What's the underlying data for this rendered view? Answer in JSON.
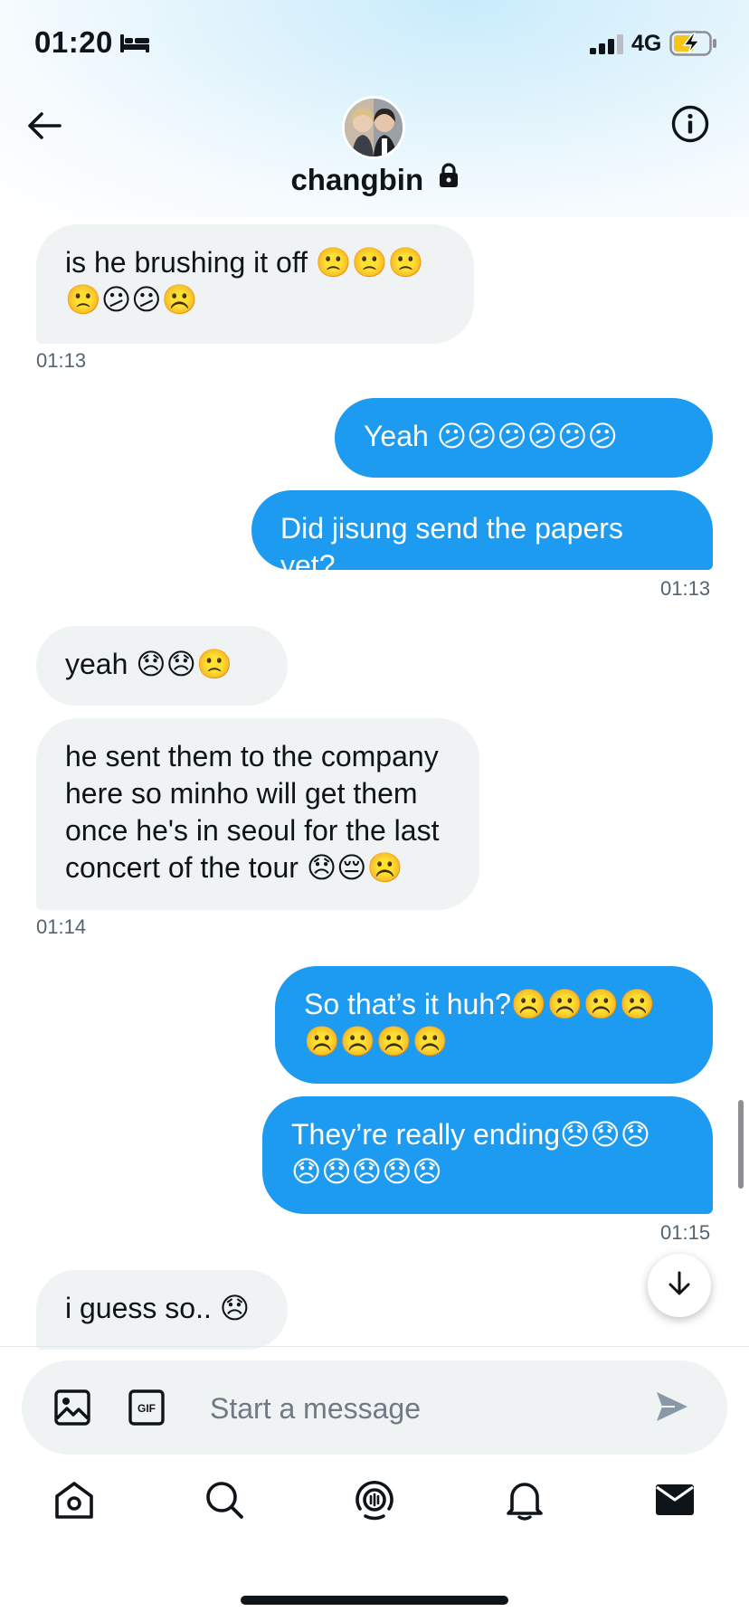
{
  "status_bar": {
    "time": "01:20",
    "network": "4G",
    "icons": [
      "bed-icon",
      "signal-icon",
      "battery-charging-icon"
    ]
  },
  "header": {
    "contact_name": "changbin",
    "icons": [
      "back-arrow-icon",
      "lock-icon",
      "info-icon"
    ]
  },
  "messages": [
    {
      "side": "received",
      "text": "is he brushing it off 🙁🙁🙁 🙁😕😕☹️"
    },
    {
      "side": "timestamp",
      "text": "01:13"
    },
    {
      "side": "sent",
      "text": "Yeah 😕😕😕😕😕😕"
    },
    {
      "side": "sent",
      "text": "Did jisung send the papers yet?"
    },
    {
      "side": "timestamp",
      "text": "01:13"
    },
    {
      "side": "received",
      "text": "yeah 😞😞🙁"
    },
    {
      "side": "received",
      "text": "he sent them to the company here so minho will get them once he's in seoul for the last concert of the tour 😞😔☹️"
    },
    {
      "side": "timestamp",
      "text": "01:14"
    },
    {
      "side": "sent",
      "text": "So that’s it huh?☹️☹️☹️☹️ ☹️☹️☹️☹️"
    },
    {
      "side": "sent",
      "text": "They’re really ending😞😞😞 😞😞😞😞😞"
    },
    {
      "side": "timestamp",
      "text": "01:15"
    },
    {
      "side": "received",
      "text": "i guess so.. 😞"
    }
  ],
  "composer": {
    "placeholder": "Start a message",
    "icons": [
      "image-icon",
      "gif-icon",
      "send-icon"
    ]
  },
  "bottom_nav": {
    "items": [
      "home-icon",
      "search-icon",
      "spaces-icon",
      "notifications-icon",
      "messages-icon"
    ],
    "active": "messages-icon"
  },
  "colors": {
    "accent": "#1d9bf0",
    "received_bubble": "#eff3f4",
    "text": "#0f1419",
    "secondary_text": "#536471"
  }
}
